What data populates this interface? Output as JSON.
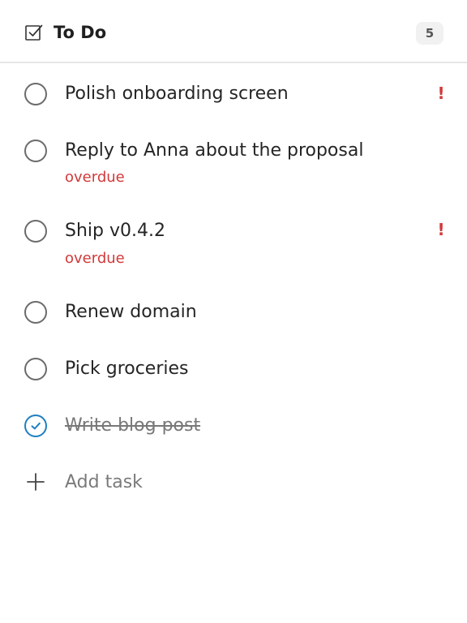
{
  "header": {
    "title": "To Do",
    "count": "5",
    "icon": "checkbox-icon"
  },
  "tasks": [
    {
      "title": "Polish onboarding screen",
      "completed": false,
      "meta": "",
      "priority": "!"
    },
    {
      "title": "Reply to Anna about the proposal",
      "completed": false,
      "meta": "overdue",
      "priority": ""
    },
    {
      "title": "Ship v0.4.2",
      "completed": false,
      "meta": "overdue",
      "priority": "!"
    },
    {
      "title": "Renew domain",
      "completed": false,
      "meta": "",
      "priority": ""
    },
    {
      "title": "Pick groceries",
      "completed": false,
      "meta": "",
      "priority": ""
    },
    {
      "title": "Write blog post",
      "completed": true,
      "meta": "",
      "priority": ""
    }
  ],
  "add_task": {
    "label": "Add task",
    "icon": "plus-icon"
  },
  "colors": {
    "accent": "#1f7fc1",
    "overdue": "#d13a3a",
    "circle": "#6b6b6b",
    "divider": "#e6e6e6"
  }
}
